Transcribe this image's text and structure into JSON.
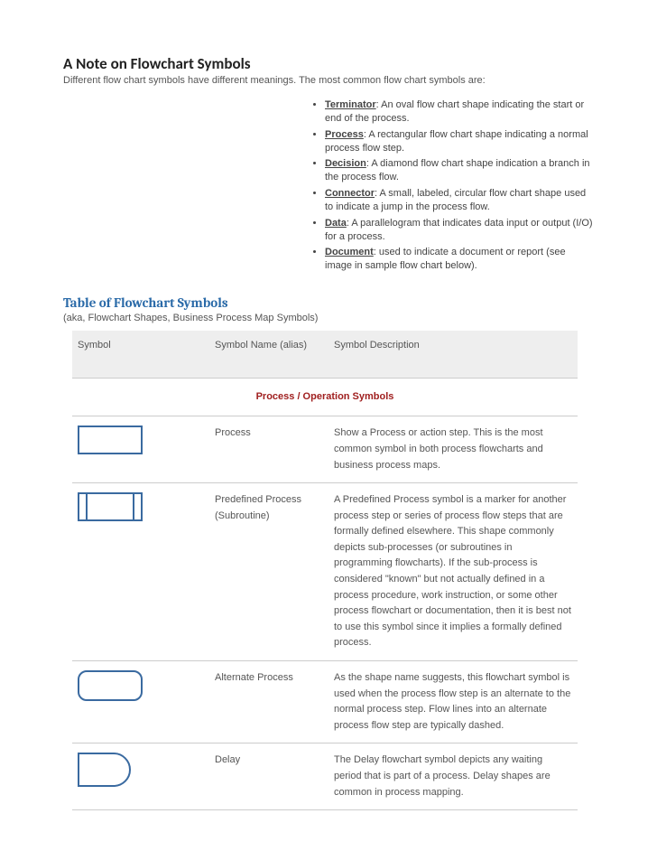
{
  "heading": "A Note on Flowchart Symbols",
  "intro": "Different flow chart symbols have different meanings. The most common flow chart symbols are:",
  "definitions": [
    {
      "term": "Terminator",
      "desc": ": An oval flow chart shape indicating the start or end of the process."
    },
    {
      "term": "Process",
      "desc": ": A rectangular flow chart shape indicating a normal process flow step."
    },
    {
      "term": "Decision",
      "desc": ": A diamond flow chart shape indication a branch in the process flow."
    },
    {
      "term": "Connector",
      "desc": ": A small, labeled, circular flow chart shape used to indicate a jump in the process flow."
    },
    {
      "term": "Data",
      "desc": ": A parallelogram that indicates data input or output (I/O) for a process."
    },
    {
      "term": "Document",
      "desc": ": used to indicate a document or report (see image in sample flow chart below)."
    }
  ],
  "table_title": "Table of Flowchart Symbols",
  "table_subtitle": "(aka, Flowchart Shapes, Business Process Map Symbols)",
  "columns": {
    "c0": "Symbol",
    "c1": "Symbol Name (alias)",
    "c2": "Symbol Description"
  },
  "section1": "Process / Operation Symbols",
  "rows": [
    {
      "name": "Process",
      "desc": "Show a Process or action step. This is the most common symbol in both process flowcharts and business process maps."
    },
    {
      "name": "Predefined Process (Subroutine)",
      "desc": "A Predefined Process symbol is a marker for another process step or series of process flow steps that are formally defined elsewhere. This shape commonly depicts sub-processes (or subroutines in programming flowcharts). If the sub-process is considered \"known\" but not actually defined in a process procedure, work instruction, or some other process flowchart or documentation, then it is best not to use this symbol since it implies a formally defined process."
    },
    {
      "name": "Alternate Process",
      "desc": "As the shape name suggests, this flowchart symbol is used when the process flow step is an alternate to the normal process step. Flow lines into an alternate process flow step are typically dashed."
    },
    {
      "name": "Delay",
      "desc": "The Delay flowchart symbol depicts any waiting period that is part of a process. Delay shapes are common in process mapping."
    }
  ]
}
